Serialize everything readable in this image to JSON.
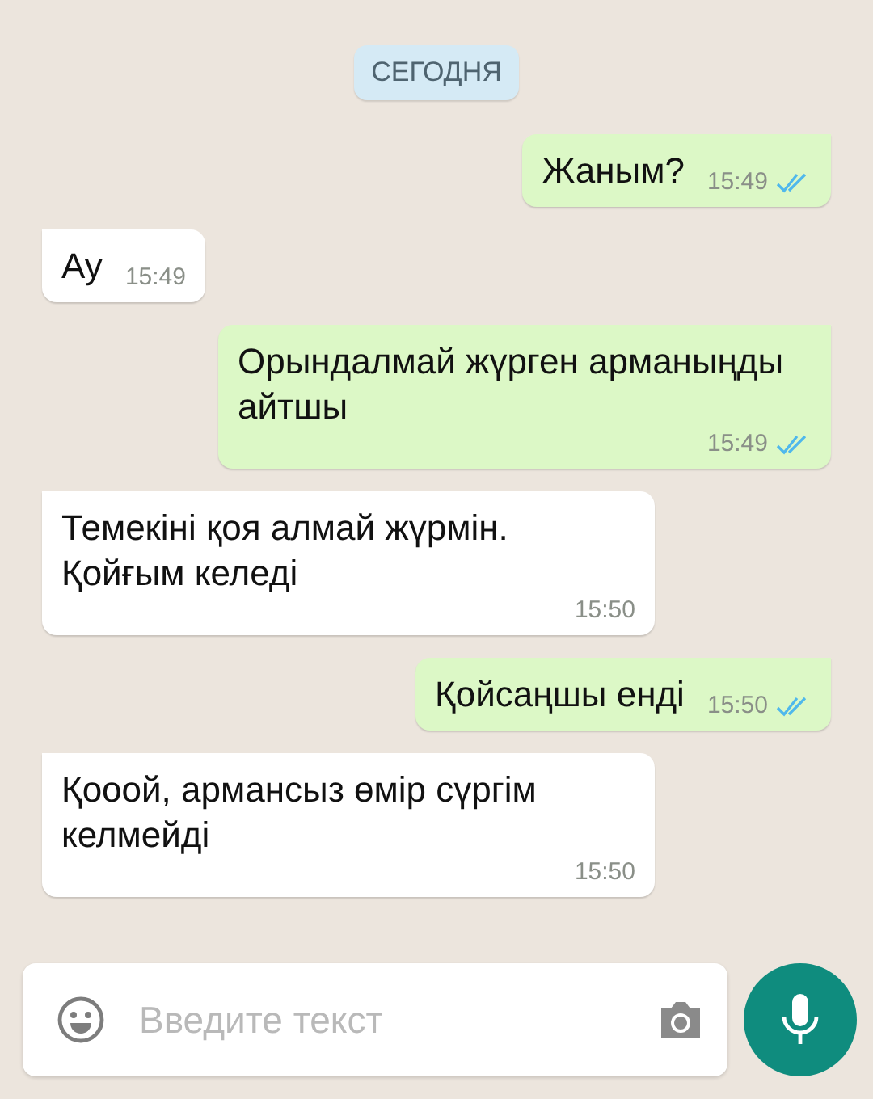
{
  "date_chip": "СЕГОДНЯ",
  "messages": [
    {
      "kind": "outgoing",
      "text": "Жаным?",
      "time": "15:49",
      "read": true
    },
    {
      "kind": "incoming",
      "text": "Ау",
      "time": "15:49"
    },
    {
      "kind": "outgoing",
      "text": "Орындалмай жүрген арманыңды айтшы",
      "time": "15:49",
      "read": true
    },
    {
      "kind": "incoming",
      "text": "Темекіні қоя алмай жүрмін. Қойғым келеді",
      "time": "15:50"
    },
    {
      "kind": "outgoing",
      "text": "Қойсаңшы енді",
      "time": "15:50",
      "read": true
    },
    {
      "kind": "incoming",
      "text": "Қооой, армансыз өмір сүргім келмейді",
      "time": "15:50"
    }
  ],
  "composer": {
    "placeholder": "Введите текст"
  }
}
